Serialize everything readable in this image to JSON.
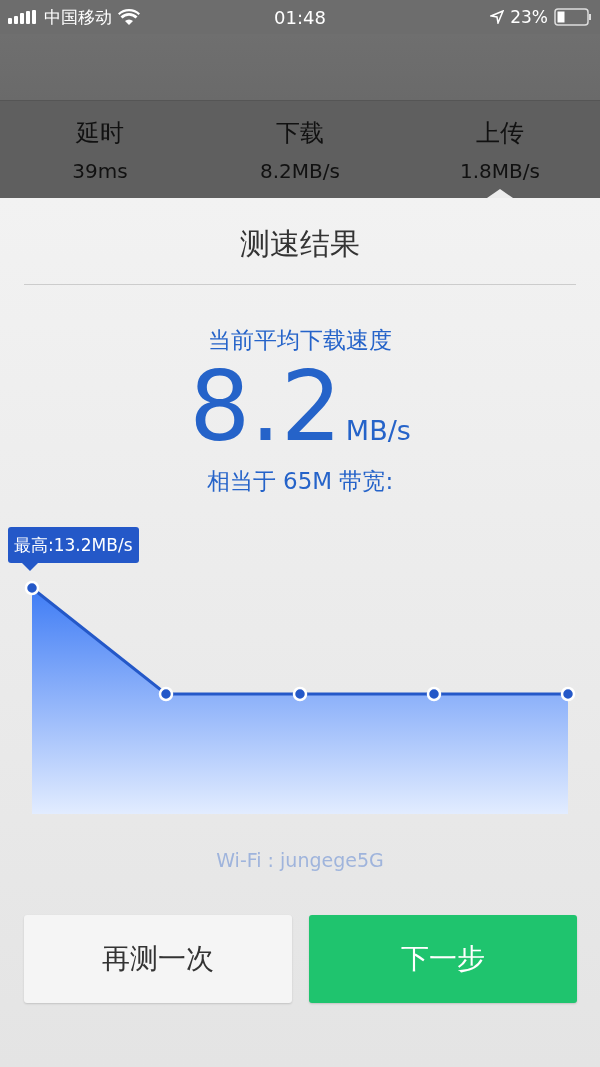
{
  "status_bar": {
    "carrier": "中国移动",
    "time": "01:48",
    "battery": "23%"
  },
  "stats": [
    {
      "label": "延时",
      "value": "39ms",
      "selected": false
    },
    {
      "label": "下载",
      "value": "8.2MB/s",
      "selected": false
    },
    {
      "label": "上传",
      "value": "1.8MB/s",
      "selected": true
    }
  ],
  "result": {
    "title": "测速结果",
    "subtitle": "当前平均下载速度",
    "speed": "8.2",
    "unit": "MB/s",
    "bandwidth": "相当于 65M 带宽:"
  },
  "chart": {
    "kind": "picture",
    "tooltip": "最高:13.2MB/s"
  },
  "network": "Wi-Fi : jungege5G",
  "buttons": [
    {
      "label": "再测一次",
      "kind": "secondary"
    },
    {
      "label": "下一步",
      "kind": "primary"
    }
  ]
}
